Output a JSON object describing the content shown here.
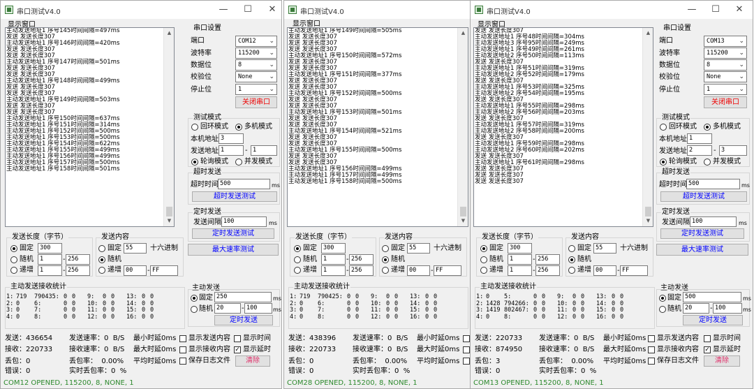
{
  "common": {
    "title": "串口测试V4.0",
    "display_window": "显示窗口",
    "serial_settings": "串口设置",
    "port": "端口",
    "baud_rate": "波特率",
    "data_bits": "数据位",
    "parity": "校验位",
    "stop_bits": "停止位",
    "close_port": "关闭串口",
    "test_mode": "测试模式",
    "loopback_mode": "回环模式",
    "multi_mode": "多机模式",
    "local_addr": "本机地址",
    "send_addr": "发送地址",
    "poll_mode": "轮询模式",
    "concurrent_mode": "并发模式",
    "timeout_send": "超时发送",
    "timeout_time": "超时时间",
    "ms": "ms",
    "timeout_send_test": "超时发送测试",
    "timed_send": "定时发送",
    "send_interval": "发送间隔",
    "timed_send_test": "定时发送测试",
    "max_rate_test": "最大速率测试",
    "send_length": "发送长度（字节）",
    "fixed": "固定",
    "random": "随机",
    "increment": "递增",
    "send_content": "发送内容",
    "hex": "十六进制",
    "active_stats": "主动发送接收统计",
    "active_send": "主动发送",
    "timed_send_btn": "定时发送",
    "send_rate": "发送速率：",
    "recv_rate": "接收速率：",
    "bps": "B/S",
    "min_delay": "最小时延",
    "max_delay": "最大时延",
    "avg_delay": "平均时延",
    "show_send": "显示发送内容",
    "show_recv": "显示接收内容",
    "save_log": "保存日志文件",
    "show_time": "显示时间",
    "show_delay": "显示延时",
    "clear": "清除",
    "sent_label": "发送：",
    "recv_label": "接收：",
    "lost_label": "丢包：",
    "err_label": "错误：",
    "loss_rate_label": "丢包率：",
    "rt_loss_label": "实时丢包率：",
    "pct": "%",
    "to_sep": "-"
  },
  "windows": [
    {
      "log_lines": [
        "主动发送地址1 序号145时间间隔=497ms",
        "发送 发送长度307",
        "主动发送地址1 序号146时间间隔=420ms",
        "发送 发送长度307",
        "发送 发送长度307",
        "主动发送地址1 序号147时间间隔=501ms",
        "发送 发送长度307",
        "发送 发送长度307",
        "主动发送地址1 序号148时间间隔=499ms",
        "发送 发送长度307",
        "发送 发送长度307",
        "主动发送地址1 序号149时间间隔=503ms",
        "发送 发送长度307",
        "发送 发送长度307",
        "主动发送地址1 序号150时间间隔=637ms",
        "主动发送地址1 序号151时间间隔=314ms",
        "主动发送地址1 序号152时间间隔=500ms",
        "主动发送地址1 序号153时间间隔=500ms",
        "主动发送地址1 序号154时间间隔=622ms",
        "主动发送地址1 序号155时间间隔=499ms",
        "主动发送地址1 序号156时间间隔=499ms",
        "主动发送地址1 序号157时间间隔=500ms",
        "主动发送地址1 序号158时间间隔=501ms"
      ],
      "port": "COM12",
      "baud": "115200",
      "data_bits": "8",
      "parity": "None",
      "stop_bits": "1",
      "local_addr": "3",
      "send_addr_from": "1",
      "send_addr_to": "1",
      "timeout_ms": "500",
      "interval_ms": "100",
      "len_fixed": "300",
      "len_rand_from": "1",
      "len_rand_to": "256",
      "len_inc_from": "1",
      "len_inc_to": "256",
      "content_fixed": "55",
      "content_inc_from": "00",
      "content_inc_to": "FF",
      "stats": [
        [
          "1:",
          "719",
          "790435:",
          "0",
          "0",
          "9:",
          "0",
          "0",
          "13:",
          "0",
          "0"
        ],
        [
          "2:",
          "0",
          "6:",
          "0",
          "0",
          "10:",
          "0",
          "0",
          "14:",
          "0",
          "0"
        ],
        [
          "3:",
          "0",
          "7:",
          "0",
          "0",
          "11:",
          "0",
          "0",
          "15:",
          "0",
          "0"
        ],
        [
          "4:",
          "0",
          "8:",
          "0",
          "0",
          "12:",
          "0",
          "0",
          "16:",
          "0",
          "0"
        ]
      ],
      "active_fixed": "250",
      "active_rand_from": "20",
      "active_rand_to": "100",
      "sent": "436654",
      "recv": "220733",
      "lost": "0",
      "err": "0",
      "send_rate": "0",
      "recv_rate": "0",
      "loss_rate": "0.00%",
      "rt_loss": "0",
      "min_delay": "0ms",
      "max_delay": "0ms",
      "avg_delay": "0ms",
      "status": "COM12 OPENED, 115200, 8, NONE, 1"
    },
    {
      "log_lines": [
        "主动发送地址1 序号149时间间隔=505ms",
        "发送 发送长度307",
        "发送 发送长度307",
        "发送 发送长度307",
        "主动发送地址1 序号150时间间隔=572ms",
        "发送 发送长度307",
        "发送 发送长度307",
        "主动发送地址1 序号151时间间隔=377ms",
        "发送 发送长度307",
        "发送 发送长度307",
        "主动发送地址1 序号152时间间隔=500ms",
        "发送 发送长度307",
        "发送 发送长度307",
        "主动发送地址1 序号153时间间隔=501ms",
        "发送 发送长度307",
        "发送 发送长度307",
        "主动发送地址1 序号154时间间隔=521ms",
        "发送 发送长度307",
        "发送 发送长度307",
        "主动发送地址1 序号155时间间隔=500ms",
        "发送 发送长度307",
        "发送 发送长度307",
        "主动发送地址1 序号156时间间隔=499ms",
        "主动发送地址1 序号157时间间隔=499ms",
        "主动发送地址1 序号158时间间隔=500ms"
      ],
      "port": "COM28",
      "baud": "115200",
      "data_bits": "8",
      "parity": "None",
      "stop_bits": "1",
      "local_addr": "",
      "send_addr_from": "",
      "send_addr_to": "",
      "timeout_ms": "",
      "interval_ms": "",
      "len_fixed": "300",
      "len_rand_from": "1",
      "len_rand_to": "256",
      "len_inc_from": "1",
      "len_inc_to": "256",
      "content_fixed": "55",
      "content_inc_from": "00",
      "content_inc_to": "FF",
      "stats": [
        [
          "1:",
          "719",
          "790425:",
          "0",
          "0",
          "9:",
          "0",
          "0",
          "13:",
          "0",
          "0"
        ],
        [
          "2:",
          "0",
          "6:",
          "0",
          "0",
          "10:",
          "0",
          "0",
          "14:",
          "0",
          "0"
        ],
        [
          "3:",
          "0",
          "7:",
          "0",
          "0",
          "11:",
          "0",
          "0",
          "15:",
          "0",
          "0"
        ],
        [
          "4:",
          "0",
          "8:",
          "0",
          "0",
          "12:",
          "0",
          "0",
          "16:",
          "0",
          "0"
        ]
      ],
      "sent": "438396",
      "recv": "220733",
      "lost": "0",
      "err": "0",
      "send_rate": "0",
      "recv_rate": "0",
      "loss_rate": "0.00%",
      "rt_loss": "0",
      "min_delay": "0ms",
      "max_delay": "0ms",
      "avg_delay": "0ms",
      "status": "COM28 OPENED, 115200, 8, NONE, 1"
    },
    {
      "log_lines": [
        "发送 发送长度307",
        "主动发送地址1 序号48时间间隔=304ms",
        "主动发送地址3 序号95时间间隔=249ms",
        "主动发送地址1 序号49时间间隔=261ms",
        "主动发送地址2 序号50时间间隔=113ms",
        "发送 发送长度307",
        "主动发送地址1 序号51时间间隔=319ms",
        "主动发送地址2 序号52时间间隔=179ms",
        "发送 发送长度307",
        "主动发送地址1 序号53时间间隔=325ms",
        "主动发送地址2 序号54时间间隔=195ms",
        "发送 发送长度307",
        "主动发送地址1 序号55时间间隔=298ms",
        "主动发送地址2 序号56时间间隔=203ms",
        "发送 发送长度307",
        "主动发送地址1 序号57时间间隔=319ms",
        "主动发送地址2 序号58时间间隔=200ms",
        "发送 发送长度307",
        "主动发送地址1 序号59时间间隔=298ms",
        "主动发送地址2 序号60时间间隔=202ms",
        "发送 发送长度307",
        "主动发送地址1 序号61时间间隔=298ms",
        "发送 发送长度307",
        "发送 发送长度307",
        "发送 发送长度307"
      ],
      "port": "COM13",
      "baud": "115200",
      "data_bits": "8",
      "parity": "None",
      "stop_bits": "1",
      "local_addr": "1",
      "send_addr_from": "2",
      "send_addr_to": "3",
      "timeout_ms": "500",
      "interval_ms": "100",
      "len_fixed": "300",
      "len_rand_from": "1",
      "len_rand_to": "256",
      "len_inc_from": "1",
      "len_inc_to": "256",
      "content_fixed": "55",
      "content_inc_from": "00",
      "content_inc_to": "FF",
      "stats": [
        [
          "1:",
          "0",
          "5:",
          "0",
          "0",
          "9:",
          "0",
          "0",
          "13:",
          "0",
          "0"
        ],
        [
          "2:",
          "1428",
          "794266:",
          "0",
          "0",
          "10:",
          "0",
          "0",
          "14:",
          "0",
          "0"
        ],
        [
          "3:",
          "1419",
          "802467:",
          "0",
          "0",
          "11:",
          "0",
          "0",
          "15:",
          "0",
          "0"
        ],
        [
          "4:",
          "0",
          "8:",
          "0",
          "0",
          "12:",
          "0",
          "0",
          "16:",
          "0",
          "0"
        ]
      ],
      "active_fixed": "500",
      "active_rand_from": "20",
      "active_rand_to": "100",
      "sent": "220733",
      "recv": "874950",
      "lost": "3",
      "err": "0",
      "send_rate": "0",
      "recv_rate": "0",
      "loss_rate": "0.00%",
      "rt_loss": "0",
      "min_delay": "0ms",
      "max_delay": "0ms",
      "avg_delay": "0ms",
      "status": "COM13 OPENED, 115200, 8, NONE, 1"
    }
  ]
}
